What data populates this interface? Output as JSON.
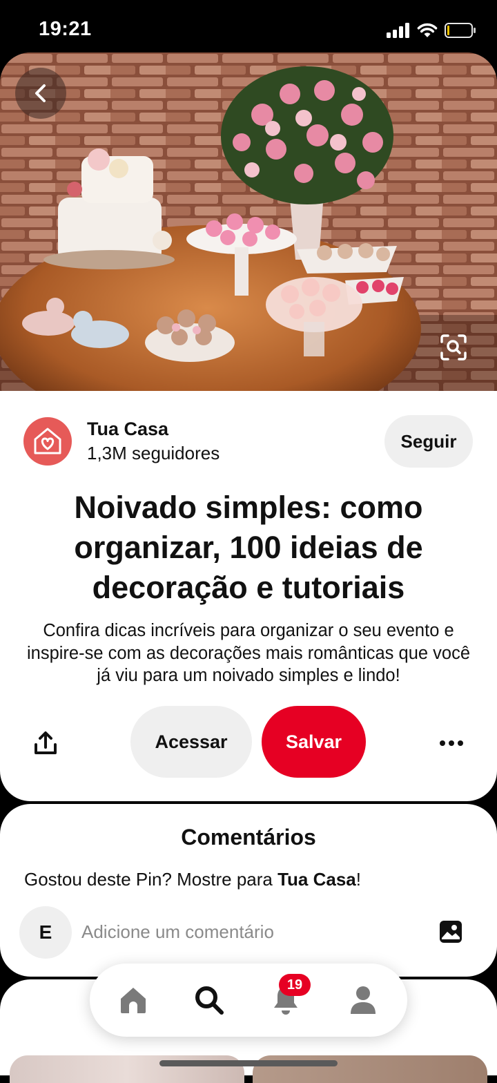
{
  "status_bar": {
    "time": "19:21"
  },
  "creator": {
    "name": "Tua Casa",
    "followers": "1,3M seguidores",
    "follow_label": "Seguir"
  },
  "pin": {
    "title": "Noivado simples: como organizar, 100 ideias de decoração e tutoriais",
    "description": "Confira dicas incríveis para organizar o seu evento e inspire-se com as decorações mais românticas que você já viu para um noivado simples e lindo!"
  },
  "actions": {
    "visit_label": "Acessar",
    "save_label": "Salvar"
  },
  "comments": {
    "title": "Comentários",
    "prompt_prefix": "Gostou deste Pin? Mostre para ",
    "prompt_name": "Tua Casa",
    "prompt_suffix": "!",
    "user_initial": "E",
    "input_placeholder": "Adicione um comentário"
  },
  "bottom_nav": {
    "items": [
      {
        "icon": "home-icon"
      },
      {
        "icon": "search-icon"
      },
      {
        "icon": "bell-icon",
        "badge": "19"
      },
      {
        "icon": "profile-icon"
      }
    ]
  },
  "colors": {
    "save": "#e60023",
    "avatar": "#e65a58",
    "button_gray": "#efefef"
  }
}
